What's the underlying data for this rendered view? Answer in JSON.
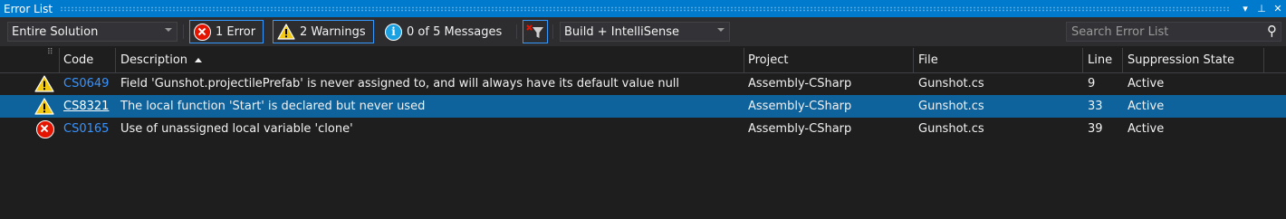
{
  "window": {
    "title": "Error List",
    "dropdown_glyph": "▾",
    "pin_glyph": "⊥",
    "close_glyph": "✕"
  },
  "toolbar": {
    "scope": "Entire Solution",
    "errors": "1 Error",
    "warnings": "2 Warnings",
    "messages": "0 of 5 Messages",
    "build_filter": "Build + IntelliSense",
    "search_placeholder": "Search Error List",
    "search_glyph": "⚲"
  },
  "columns": {
    "code": "Code",
    "description": "Description",
    "project": "Project",
    "file": "File",
    "line": "Line",
    "suppression": "Suppression State"
  },
  "rows": [
    {
      "severity": "warning",
      "code": "CS0649",
      "description": "Field 'Gunshot.projectilePrefab' is never assigned to, and will always have its default value null",
      "project": "Assembly-CSharp",
      "file": "Gunshot.cs",
      "line": "9",
      "state": "Active"
    },
    {
      "severity": "warning",
      "code": "CS8321",
      "description": "The local function 'Start' is declared but never used",
      "project": "Assembly-CSharp",
      "file": "Gunshot.cs",
      "line": "33",
      "state": "Active"
    },
    {
      "severity": "error",
      "code": "CS0165",
      "description": "Use of unassigned local variable 'clone'",
      "project": "Assembly-CSharp",
      "file": "Gunshot.cs",
      "line": "39",
      "state": "Active"
    }
  ],
  "colors": {
    "accent": "#007acc",
    "selection": "#0e639c",
    "error": "#e51400",
    "warning": "#f2c811",
    "link": "#3794ff"
  }
}
